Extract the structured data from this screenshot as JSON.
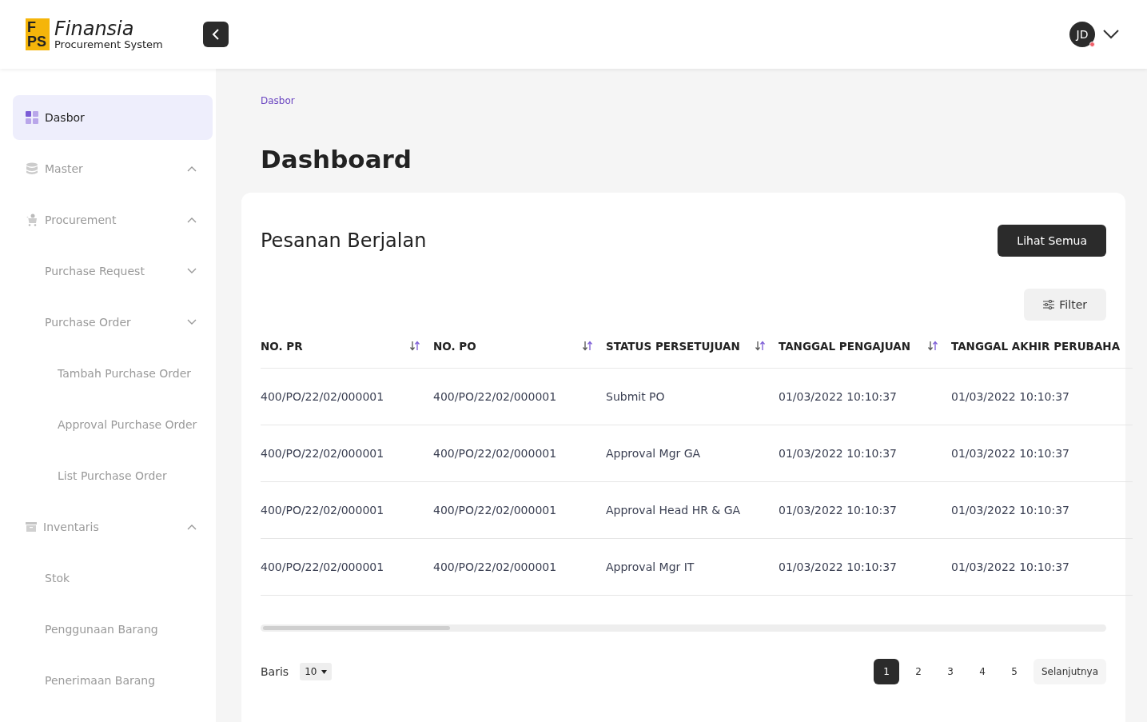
{
  "logo": {
    "mark_top": "F",
    "mark_bottom": "PS",
    "name": "Finansia",
    "subtitle": "Procurement System"
  },
  "user": {
    "initials": "JD",
    "notification": true
  },
  "sidebar": {
    "items": [
      {
        "label": "Dasbor",
        "selected": true
      },
      {
        "label": "Master",
        "selected": false,
        "expanded": true
      },
      {
        "label": "Procurement",
        "selected": false,
        "expanded": true,
        "children": [
          {
            "label": "Purchase Request",
            "selected": false,
            "expanded": false
          },
          {
            "label": "Purchase Order",
            "selected": false,
            "expanded": false,
            "children": [
              {
                "label": "Tambah Purchase Order",
                "selected": false
              },
              {
                "label": "Approval Purchase Order",
                "selected": false
              },
              {
                "label": "List Purchase Order",
                "selected": false
              }
            ]
          }
        ]
      },
      {
        "label": "Inventaris",
        "selected": false,
        "expanded": true,
        "children": [
          {
            "label": "Stok",
            "selected": false
          },
          {
            "label": "Penggunaan Barang",
            "selected": false
          },
          {
            "label": "Penerimaan Barang",
            "selected": false
          }
        ]
      }
    ]
  },
  "breadcrumb": [
    "Dasbor"
  ],
  "page_title": "Dashboard",
  "card": {
    "title": "Pesanan Berjalan",
    "view_all": "Lihat Semua",
    "filter": "Filter"
  },
  "table": {
    "columns": [
      {
        "label": "NO. PR",
        "sortable": true
      },
      {
        "label": "NO. PO",
        "sortable": true
      },
      {
        "label": "STATUS PERSETUJUAN",
        "sortable": true
      },
      {
        "label": "TANGGAL PENGAJUAN",
        "sortable": true
      },
      {
        "label": "TANGGAL AKHIR PERUBAHA",
        "sortable": false
      }
    ],
    "rows": [
      [
        "400/PO/22/02/000001",
        "400/PO/22/02/000001",
        "Submit PO",
        "01/03/2022 10:10:37",
        "01/03/2022 10:10:37"
      ],
      [
        "400/PO/22/02/000001",
        "400/PO/22/02/000001",
        "Approval Mgr GA",
        "01/03/2022 10:10:37",
        "01/03/2022 10:10:37"
      ],
      [
        "400/PO/22/02/000001",
        "400/PO/22/02/000001",
        "Approval Head HR & GA",
        "01/03/2022 10:10:37",
        "01/03/2022 10:10:37"
      ],
      [
        "400/PO/22/02/000001",
        "400/PO/22/02/000001",
        "Approval Mgr IT",
        "01/03/2022 10:10:37",
        "01/03/2022 10:10:37"
      ]
    ]
  },
  "pagination": {
    "rows_label": "Baris",
    "rows_value": "10",
    "pages": [
      {
        "label": "1",
        "selected": true
      },
      {
        "label": "2",
        "selected": false
      },
      {
        "label": "3",
        "selected": false
      },
      {
        "label": "4",
        "selected": false
      },
      {
        "label": "5",
        "selected": false
      }
    ],
    "next": "Selanjutnya"
  }
}
